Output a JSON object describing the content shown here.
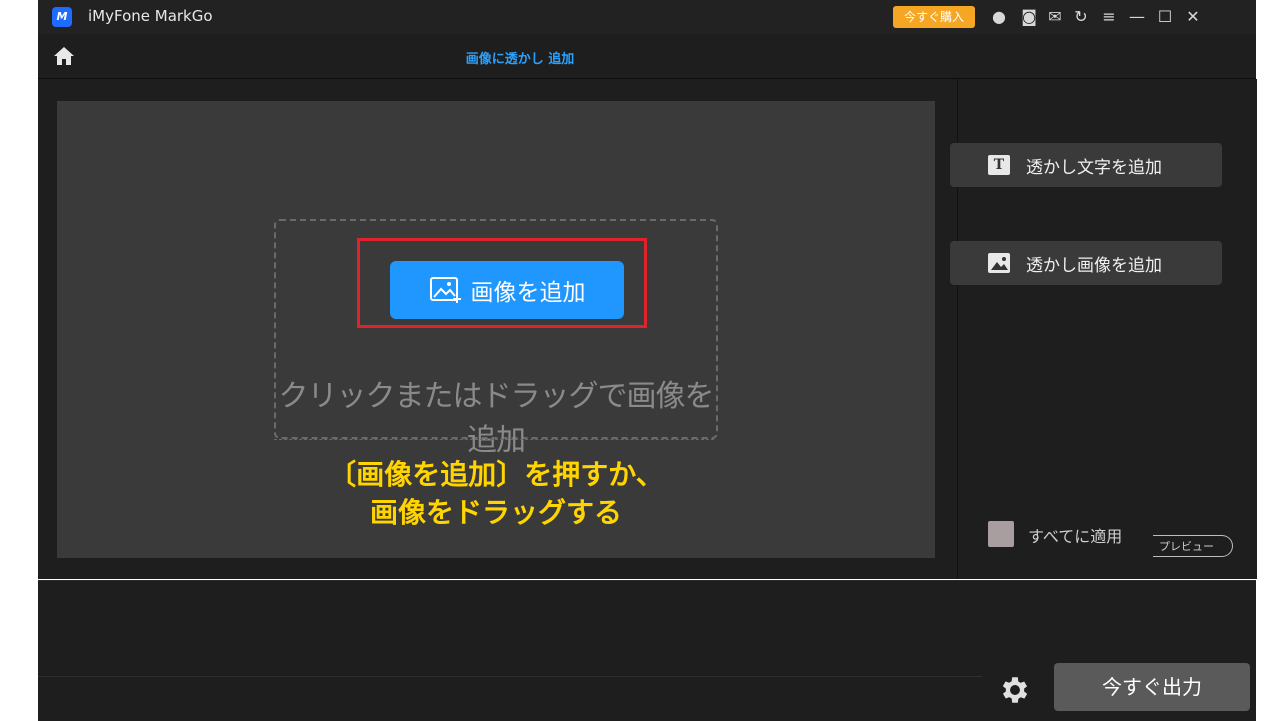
{
  "window": {
    "app_title": "iMyFone MarkGo",
    "logo_text": "M",
    "buy_label": "今すぐ購入",
    "icons": [
      "account-icon",
      "discord-icon",
      "mail-icon",
      "refresh-icon",
      "menu-icon",
      "minimize-icon",
      "maximize-icon",
      "close-icon"
    ],
    "icon_glyphs": [
      "●",
      "◙",
      "✉",
      "↻",
      "≡",
      "—",
      "☐",
      "✕"
    ]
  },
  "navbar": {
    "title": "画像に透かし 追加"
  },
  "canvas": {
    "add_image_label": "画像を追加",
    "drop_hint": "クリックまたはドラッグで画像を追加",
    "annotation_line1": "〔画像を追加〕を押すか、",
    "annotation_line2": "画像をドラッグする"
  },
  "sidebar": {
    "add_text_watermark": "透かし文字を追加",
    "text_icon_glyph": "T",
    "add_image_watermark": "透かし画像を追加",
    "apply_all_label": "すべてに適用",
    "preview_label": "プレビュー"
  },
  "footer": {
    "export_label": "今すぐ出力"
  },
  "colors": {
    "accent_blue": "#1f97ff",
    "highlight_red": "#e0222b",
    "annotation_yellow": "#ffd400",
    "buy_orange": "#f5a623"
  }
}
